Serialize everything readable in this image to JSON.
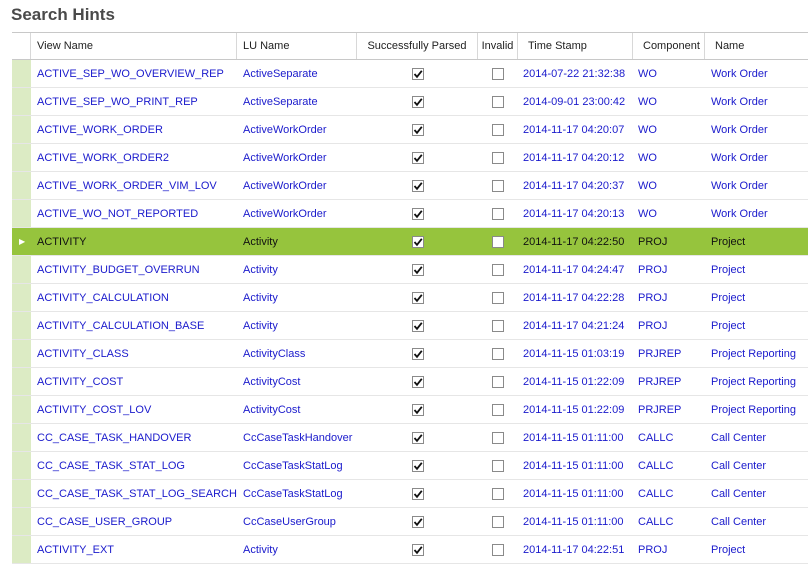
{
  "page": {
    "title": "Search Hints"
  },
  "columns": {
    "view_name": "View Name",
    "lu_name": "LU Name",
    "parsed": "Successfully Parsed",
    "invalid": "Invalid",
    "timestamp": "Time Stamp",
    "component": "Component",
    "name": "Name"
  },
  "selected_row_index": 6,
  "rows": [
    {
      "view": "ACTIVE_SEP_WO_OVERVIEW_REP",
      "lu": "ActiveSeparate",
      "parsed": true,
      "invalid": false,
      "ts": "2014-07-22 21:32:38",
      "comp": "WO",
      "name": "Work Order"
    },
    {
      "view": "ACTIVE_SEP_WO_PRINT_REP",
      "lu": "ActiveSeparate",
      "parsed": true,
      "invalid": false,
      "ts": "2014-09-01 23:00:42",
      "comp": "WO",
      "name": "Work Order"
    },
    {
      "view": "ACTIVE_WORK_ORDER",
      "lu": "ActiveWorkOrder",
      "parsed": true,
      "invalid": false,
      "ts": "2014-11-17 04:20:07",
      "comp": "WO",
      "name": "Work Order"
    },
    {
      "view": "ACTIVE_WORK_ORDER2",
      "lu": "ActiveWorkOrder",
      "parsed": true,
      "invalid": false,
      "ts": "2014-11-17 04:20:12",
      "comp": "WO",
      "name": "Work Order"
    },
    {
      "view": "ACTIVE_WORK_ORDER_VIM_LOV",
      "lu": "ActiveWorkOrder",
      "parsed": true,
      "invalid": false,
      "ts": "2014-11-17 04:20:37",
      "comp": "WO",
      "name": "Work Order"
    },
    {
      "view": "ACTIVE_WO_NOT_REPORTED",
      "lu": "ActiveWorkOrder",
      "parsed": true,
      "invalid": false,
      "ts": "2014-11-17 04:20:13",
      "comp": "WO",
      "name": "Work Order"
    },
    {
      "view": "ACTIVITY",
      "lu": "Activity",
      "parsed": true,
      "invalid": false,
      "ts": "2014-11-17 04:22:50",
      "comp": "PROJ",
      "name": "Project"
    },
    {
      "view": "ACTIVITY_BUDGET_OVERRUN",
      "lu": "Activity",
      "parsed": true,
      "invalid": false,
      "ts": "2014-11-17 04:24:47",
      "comp": "PROJ",
      "name": "Project"
    },
    {
      "view": "ACTIVITY_CALCULATION",
      "lu": "Activity",
      "parsed": true,
      "invalid": false,
      "ts": "2014-11-17 04:22:28",
      "comp": "PROJ",
      "name": "Project"
    },
    {
      "view": "ACTIVITY_CALCULATION_BASE",
      "lu": "Activity",
      "parsed": true,
      "invalid": false,
      "ts": "2014-11-17 04:21:24",
      "comp": "PROJ",
      "name": "Project"
    },
    {
      "view": "ACTIVITY_CLASS",
      "lu": "ActivityClass",
      "parsed": true,
      "invalid": false,
      "ts": "2014-11-15 01:03:19",
      "comp": "PRJREP",
      "name": "Project Reporting"
    },
    {
      "view": "ACTIVITY_COST",
      "lu": "ActivityCost",
      "parsed": true,
      "invalid": false,
      "ts": "2014-11-15 01:22:09",
      "comp": "PRJREP",
      "name": "Project Reporting"
    },
    {
      "view": "ACTIVITY_COST_LOV",
      "lu": "ActivityCost",
      "parsed": true,
      "invalid": false,
      "ts": "2014-11-15 01:22:09",
      "comp": "PRJREP",
      "name": "Project Reporting"
    },
    {
      "view": "CC_CASE_TASK_HANDOVER",
      "lu": "CcCaseTaskHandover",
      "parsed": true,
      "invalid": false,
      "ts": "2014-11-15 01:11:00",
      "comp": "CALLC",
      "name": "Call Center"
    },
    {
      "view": "CC_CASE_TASK_STAT_LOG",
      "lu": "CcCaseTaskStatLog",
      "parsed": true,
      "invalid": false,
      "ts": "2014-11-15 01:11:00",
      "comp": "CALLC",
      "name": "Call Center"
    },
    {
      "view": "CC_CASE_TASK_STAT_LOG_SEARCH",
      "lu": "CcCaseTaskStatLog",
      "parsed": true,
      "invalid": false,
      "ts": "2014-11-15 01:11:00",
      "comp": "CALLC",
      "name": "Call Center"
    },
    {
      "view": "CC_CASE_USER_GROUP",
      "lu": "CcCaseUserGroup",
      "parsed": true,
      "invalid": false,
      "ts": "2014-11-15 01:11:00",
      "comp": "CALLC",
      "name": "Call Center"
    },
    {
      "view": "ACTIVITY_EXT",
      "lu": "Activity",
      "parsed": true,
      "invalid": false,
      "ts": "2014-11-17 04:22:51",
      "comp": "PROJ",
      "name": "Project"
    }
  ],
  "icons": {
    "selected_row": "row-pointer-icon",
    "check": "checkmark-icon"
  }
}
